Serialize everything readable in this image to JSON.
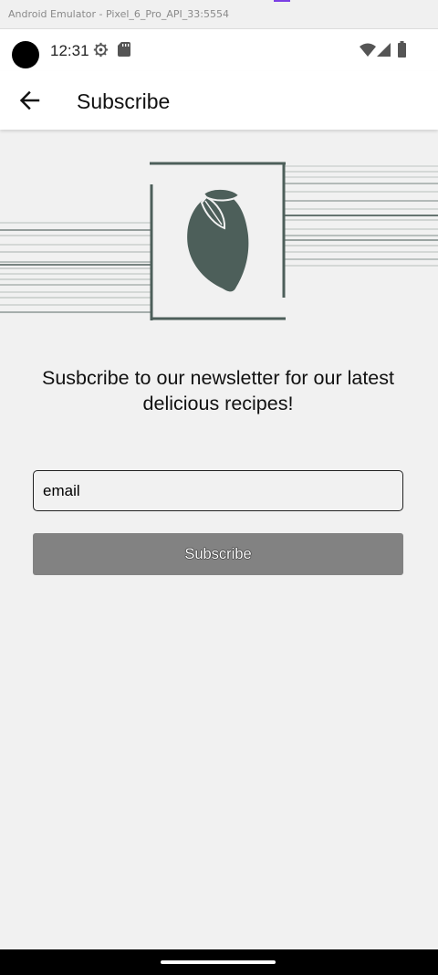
{
  "window": {
    "title": "Android Emulator - Pixel_6_Pro_API_33:5554"
  },
  "status_bar": {
    "time": "12:31",
    "icons": [
      "settings-icon",
      "sd-card-icon",
      "wifi-icon",
      "cellular-signal-icon",
      "battery-icon"
    ]
  },
  "app_bar": {
    "title": "Subscribe",
    "back_icon": "arrow-back-icon"
  },
  "content": {
    "hero_icon": "lemon-icon",
    "tagline": "Susbcribe to our newsletter for our latest delicious recipes!",
    "email_field": {
      "value": "email",
      "placeholder": "email"
    },
    "subscribe_button": {
      "label": "Subscribe"
    }
  },
  "colors": {
    "background": "#f1f1f1",
    "accent": "#4d5f5a",
    "button": "#828282",
    "app_bar": "#ffffff"
  }
}
